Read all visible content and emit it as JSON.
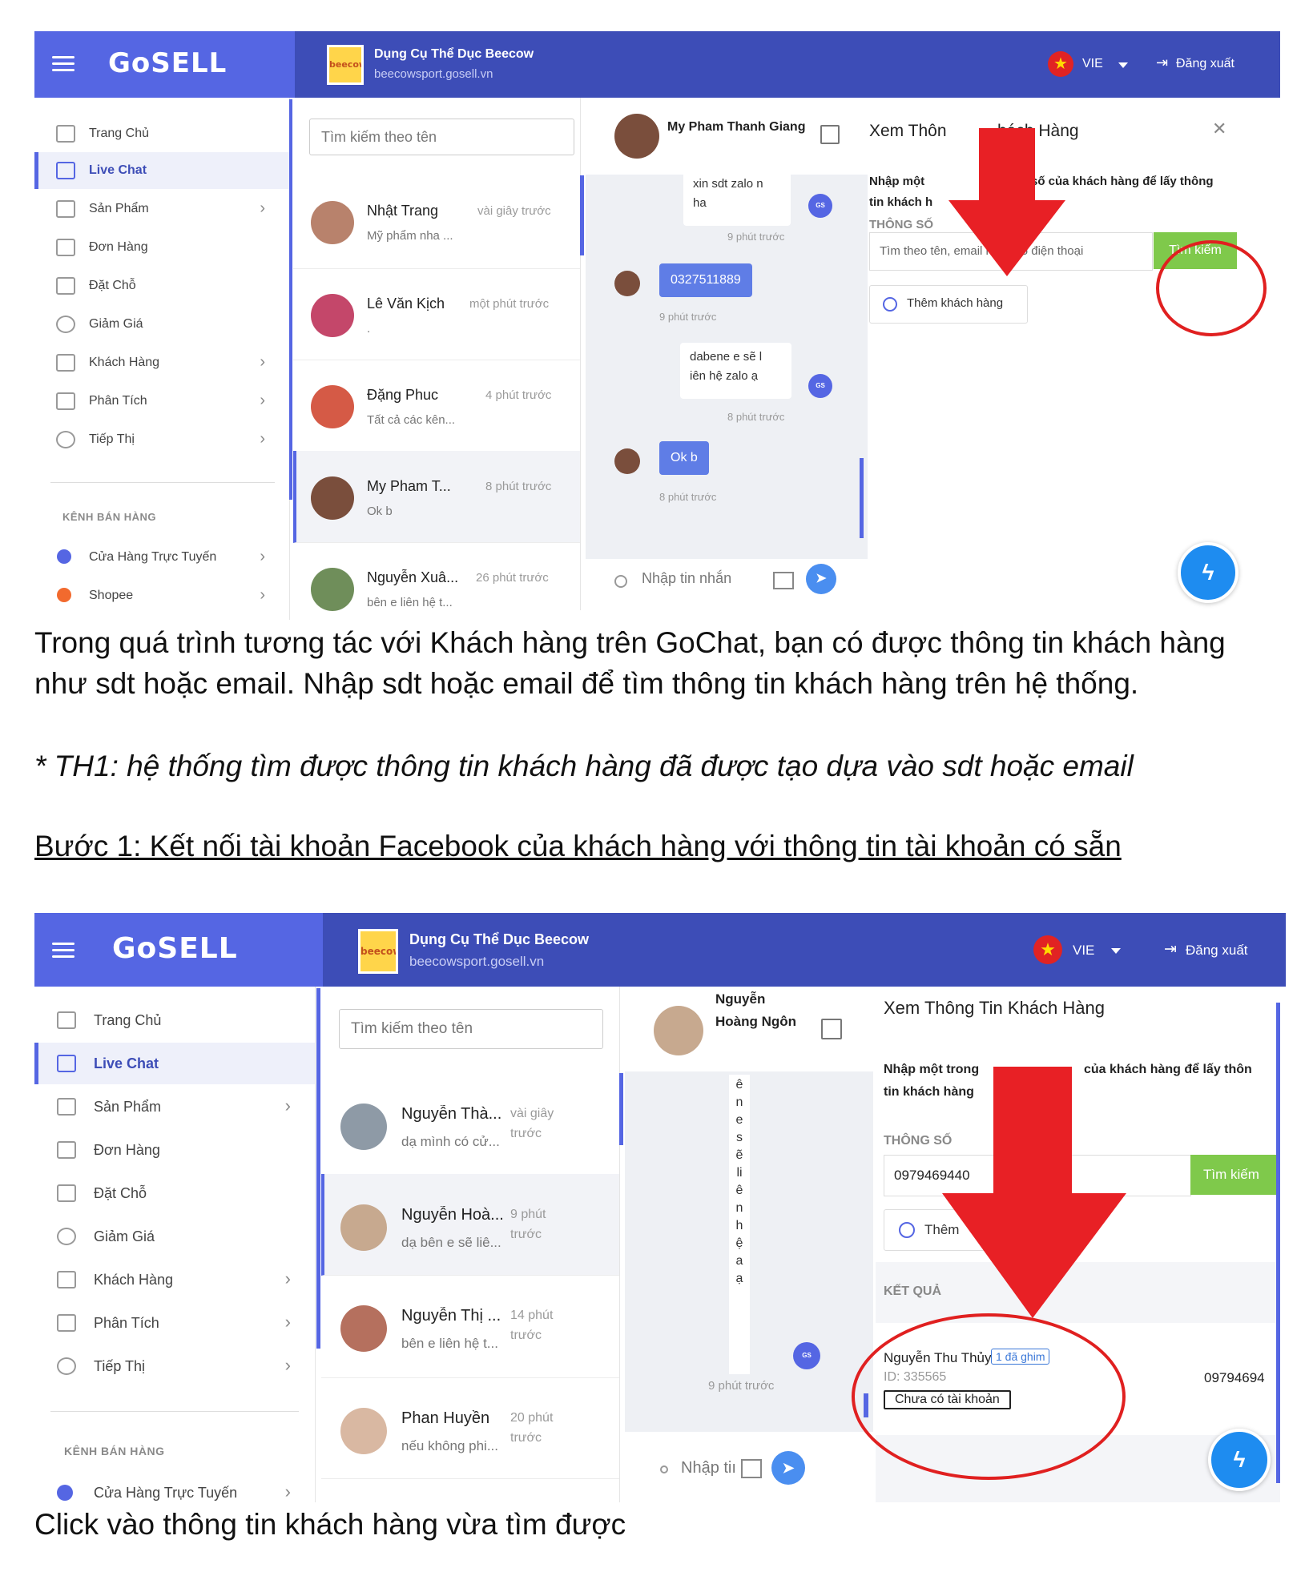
{
  "captions": {
    "c1_line1": "Trong quá trình tương tác với Khách hàng trên GoChat, bạn có được thông tin khách hàng",
    "c1_line2": "như sdt hoặc email. Nhập sdt hoặc email để tìm thông tin khách hàng trên hệ thống.",
    "c2": "* TH1: hệ thống tìm được thông tin khách hàng đã được tạo dựa vào sdt hoặc email",
    "c3": "Bước 1: Kết nối tài khoản Facebook của khách hàng với thông tin tài khoản có sẵn",
    "c4": "Click vào thông tin khách hàng vừa tìm được"
  },
  "app": {
    "logo": "GoSELL",
    "shop_logo_text": "beecow",
    "shop_name": "Dụng Cụ Thể Dục Beecow",
    "shop_url": "beecowsport.gosell.vn",
    "flag_icon": "★",
    "lang": "VIE",
    "logout": "Đăng xuất",
    "logout_icon": "⇥",
    "brand_color": "#3d4db7",
    "nav": [
      "Trang Chủ",
      "Live Chat",
      "Sản Phẩm",
      "Đơn Hàng",
      "Đặt Chỗ",
      "Giảm Giá",
      "Khách Hàng",
      "Phân Tích",
      "Tiếp Thị"
    ],
    "channels_title": "KÊNH BÁN HÀNG",
    "channels": [
      "Cửa Hàng Trực Tuyến",
      "Shopee"
    ],
    "arrow": "›",
    "search_placeholder": "Tìm kiếm theo tên",
    "chat_input_placeholder": "Nhập tin nhắn",
    "messenger_icon": "ϟ",
    "send_icon": "➤",
    "close_icon": "✕"
  },
  "s1": {
    "conversations": [
      {
        "name": "Nhật Trang",
        "time": "vài giây trước",
        "msg": "Mỹ phẩm nha ..."
      },
      {
        "name": "Lê Văn Kịch",
        "time": "một phút trước",
        "msg": "."
      },
      {
        "name": "Đặng Phuc",
        "time": "4 phút trước",
        "msg": "Tất cả các kên..."
      },
      {
        "name": "My Pham T...",
        "time": "8 phút trước",
        "msg": "Ok b"
      },
      {
        "name": "Nguyễn Xuâ...",
        "time": "26 phút trước",
        "msg": "bên e liên hệ t..."
      }
    ],
    "chat_user": "My Pham Thanh Giang",
    "messages": {
      "m1_line1": "xin sdt zalo n",
      "m1_line2": "ha",
      "m1_time": "9 phút trước",
      "m2": "0327511889",
      "m2_time": "9 phút trước",
      "m3_line1": "dabene e sẽ l",
      "m3_line2": "iên hệ zalo ạ",
      "m3_time": "8 phút trước",
      "m4": "Ok b",
      "m4_time": "8 phút trước"
    },
    "panel_title_a": "Xem Thôn",
    "panel_title_b": "hách Hàng",
    "panel_text_a": "Nhập một",
    "panel_text_b": "số của khách hàng để lấy thông",
    "panel_text_c": "tin khách h",
    "param_label": "THÔNG SỐ",
    "param_placeholder": "Tìm theo tên, email hoặc số điện thoại",
    "search_button": "Tìm kiếm",
    "add_customer": "Thêm khách hàng"
  },
  "s2": {
    "conversations": [
      {
        "name": "Nguyễn Thà...",
        "time_a": "vài giây",
        "time_b": "trước",
        "msg": "dạ mình có cử..."
      },
      {
        "name": "Nguyễn Hoà...",
        "time_a": "9 phút",
        "time_b": "trước",
        "msg": "dạ bên e sẽ liê..."
      },
      {
        "name": "Nguyễn Thị ...",
        "time_a": "14 phút",
        "time_b": "trước",
        "msg": "bên e liên hệ t..."
      },
      {
        "name": "Phan Huyền",
        "time_a": "20 phút",
        "time_b": "trước",
        "msg": "nếu không phi..."
      }
    ],
    "chat_user_line1": "Nguyễn",
    "chat_user_line2": "Hoàng Ngôn",
    "vertical_letters": [
      "ê",
      "n",
      "e",
      "s",
      "ẽ",
      "li",
      "ê",
      "n",
      "h",
      "ệ",
      "a",
      "ạ"
    ],
    "msg_time": "9 phút trước",
    "chat_input": "Nhập tiı",
    "panel_title": "Xem Thông Tin Khách Hàng",
    "panel_text_a": "Nhập một trong",
    "panel_text_b": "của khách hàng để lấy thôn",
    "panel_text_c": "tin khách hàng",
    "param_label": "THÔNG SỐ",
    "param_value": "0979469440",
    "search_button": "Tìm kiếm",
    "add_button": "Thêm",
    "result_label": "KẾT QUẢ",
    "result_name": "Nguyễn Thu Thủy",
    "result_badge": "1 đã ghim",
    "result_id": "ID: 335565",
    "result_phone": "09794694",
    "result_status": "Chưa có tài khoản"
  }
}
